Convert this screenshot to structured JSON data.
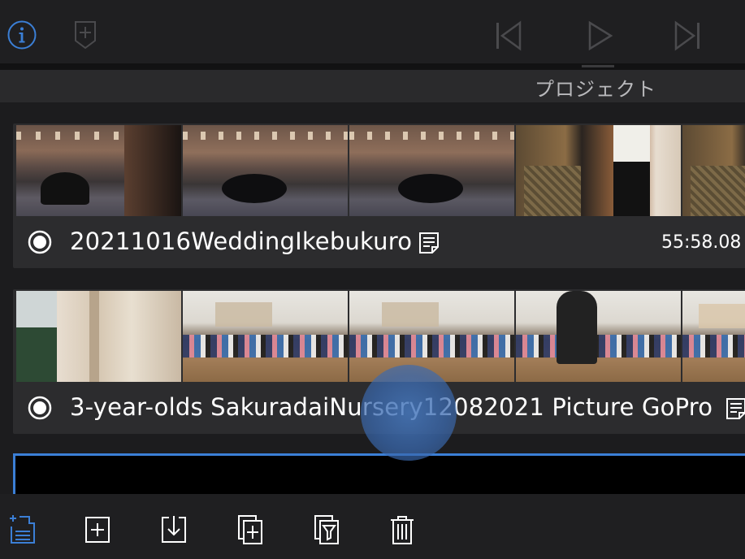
{
  "toolbar": {
    "icons": [
      "info-icon",
      "add-clip-icon",
      "skip-back-icon",
      "play-icon",
      "skip-forward-icon"
    ]
  },
  "header": {
    "tab_label": "プロジェクト"
  },
  "projects": [
    {
      "title": "20211016WeddingIkebukuro",
      "duration": "55:58.08",
      "selected": false
    },
    {
      "title": "3-year-olds SakuradaiNursery12082021 Picture GoPro",
      "duration": "",
      "selected": false
    },
    {
      "title": "",
      "duration": "",
      "selected": true
    }
  ],
  "bottom_toolbar": {
    "icons": [
      "new-project-icon",
      "add-icon",
      "import-icon",
      "duplicate-icon",
      "filter-icon",
      "trash-icon"
    ]
  },
  "colors": {
    "accent": "#3b7fd6",
    "inactive_icon": "#4a4a4d",
    "background": "#1c1c1e"
  }
}
